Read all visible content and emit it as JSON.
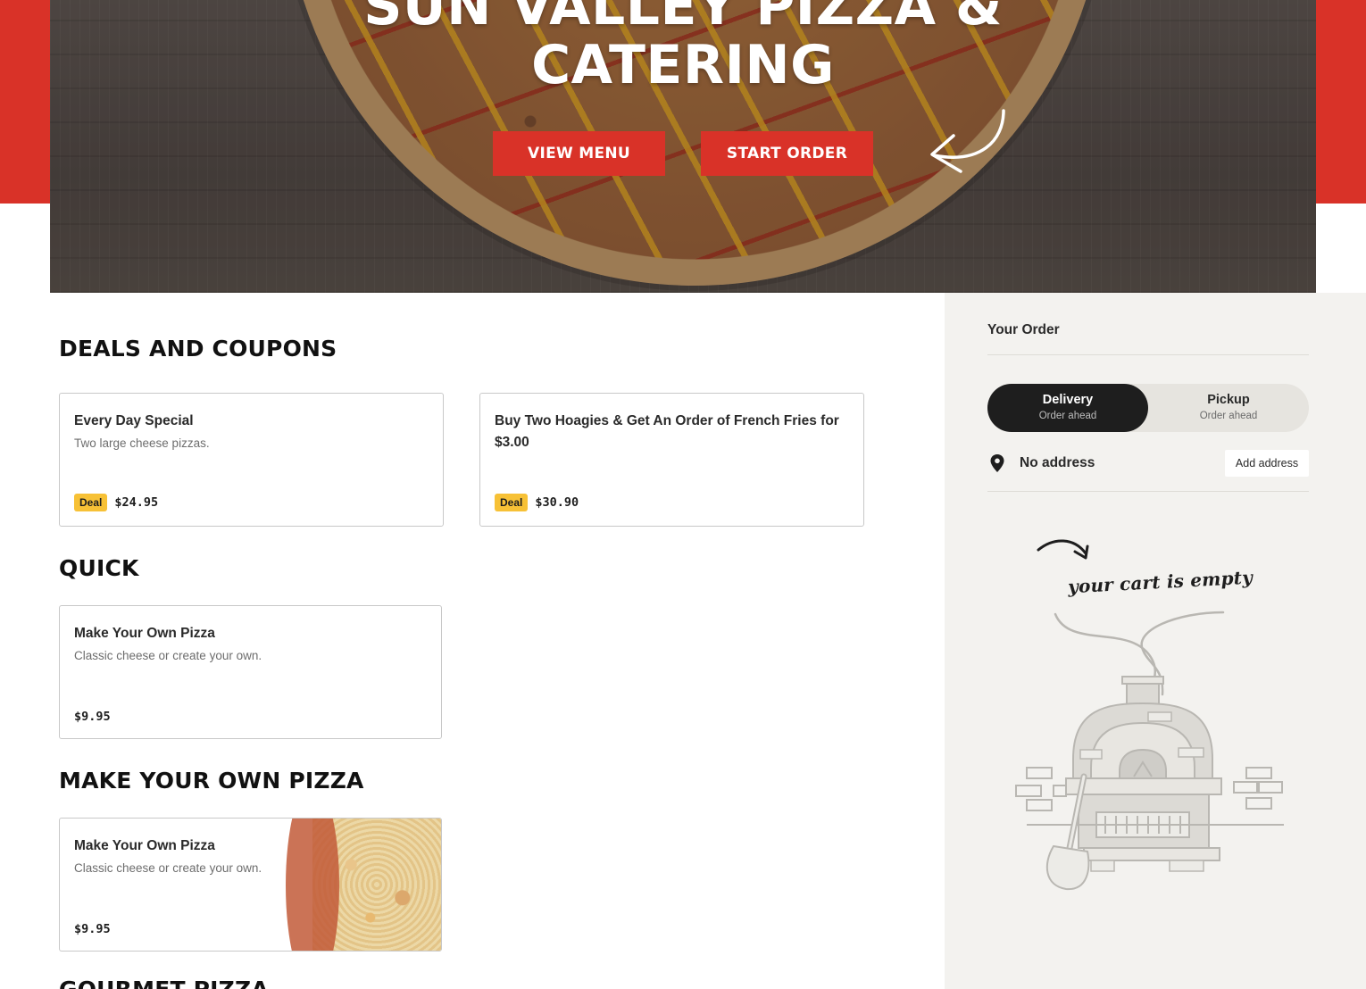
{
  "hero": {
    "title_line1": "SUN VALLEY PIZZA &",
    "title_line2": "CATERING",
    "view_menu_label": "VIEW MENU",
    "start_order_label": "START ORDER"
  },
  "sections": {
    "deals": {
      "title": "DEALS AND COUPONS",
      "cards": [
        {
          "name": "Every Day Special",
          "description": "Two large cheese pizzas.",
          "badge": "Deal",
          "price": "$24.95"
        },
        {
          "name": "Buy Two Hoagies & Get An Order of French Fries for $3.00",
          "description": "",
          "badge": "Deal",
          "price": "$30.90"
        }
      ]
    },
    "quick": {
      "title": "QUICK",
      "cards": [
        {
          "name": "Make Your Own Pizza",
          "description": "Classic cheese or create your own.",
          "price": "$9.95"
        }
      ]
    },
    "myop": {
      "title": "MAKE YOUR OWN PIZZA",
      "cards": [
        {
          "name": "Make Your Own Pizza",
          "description": "Classic cheese or create your own.",
          "price": "$9.95"
        }
      ]
    },
    "gourmet": {
      "title": "GOURMET PIZZA"
    }
  },
  "order_panel": {
    "title": "Your Order",
    "delivery_label": "Delivery",
    "delivery_sub": "Order ahead",
    "pickup_label": "Pickup",
    "pickup_sub": "Order ahead",
    "address_text": "No address",
    "add_address_label": "Add address",
    "empty_cart_text": "your cart is empty"
  },
  "colors": {
    "brand_red": "#d93228",
    "deal_yellow": "#f7c136",
    "sidebar_bg": "#f3f2ef",
    "toggle_active": "#1e1e1e"
  },
  "icons": {
    "location": "pin-icon",
    "hero_arrow": "curved-arrow-icon",
    "cart_arrow": "curved-arrow-icon",
    "oven": "pizza-oven-illustration"
  }
}
